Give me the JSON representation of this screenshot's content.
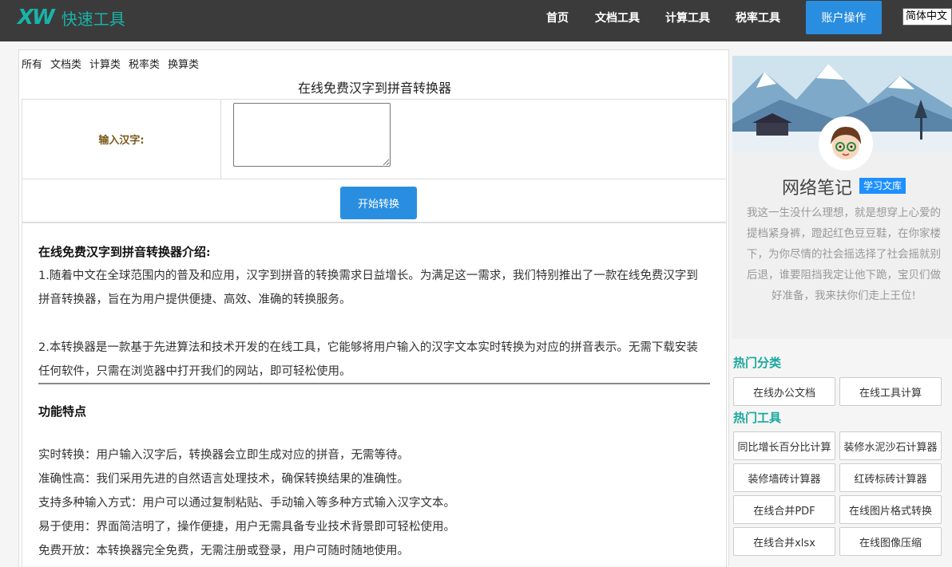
{
  "header": {
    "logo_mark": "XW",
    "logo_name": "快速工具",
    "nav": [
      "首页",
      "文档工具",
      "计算工具",
      "税率工具"
    ],
    "account_button": "账户操作",
    "language": "简体中文"
  },
  "categories": [
    "所有",
    "文档类",
    "计算类",
    "税率类",
    "换算类"
  ],
  "page_title": "在线免费汉字到拼音转换器",
  "form": {
    "input_label": "输入汉字:",
    "input_value": "",
    "submit_label": "开始转换"
  },
  "article": {
    "intro_heading": "在线免费汉字到拼音转换器介绍:",
    "para1": "1.随着中文在全球范围内的普及和应用，汉字到拼音的转换需求日益增长。为满足这一需求，我们特别推出了一款在线免费汉字到拼音转换器，旨在为用户提供便捷、高效、准确的转换服务。",
    "para2": "2.本转换器是一款基于先进算法和技术开发的在线工具，它能够将用户输入的汉字文本实时转换为对应的拼音表示。无需下载安装任何软件，只需在浏览器中打开我们的网站，即可轻松使用。",
    "features_heading": "功能特点",
    "features": [
      "实时转换：用户输入汉字后，转换器会立即生成对应的拼音，无需等待。",
      "准确性高：我们采用先进的自然语言处理技术，确保转换结果的准确性。",
      "支持多种输入方式：用户可以通过复制粘贴、手动输入等多种方式输入汉字文本。",
      "易于使用：界面简洁明了，操作便捷，用户无需具备专业技术背景即可轻松使用。",
      "免费开放：本转换器完全免费，无需注册或登录，用户可随时随地使用。"
    ]
  },
  "sidebar": {
    "name": "网络笔记",
    "badge": "学习文库",
    "description": "我这一生没什么理想，就是想穿上心爱的提档紧身裤，蹬起红色豆豆鞋，在你家楼下，为你尽情的社会摇选择了社会摇就别后退，谁要阻挡我定让他下跪，宝贝们做好准备，我来扶你们走上王位!",
    "hot_categories_title": "热门分类",
    "hot_categories": [
      "在线办公文档",
      "在线工具计算"
    ],
    "hot_tools_title": "热门工具",
    "hot_tools": [
      "同比增长百分比计算",
      "装修水泥沙石计算器",
      "装修墙砖计算器",
      "红砖标砖计算器",
      "在线合并PDF",
      "在线图片格式转换",
      "在线合并xlsx",
      "在线图像压缩"
    ]
  }
}
